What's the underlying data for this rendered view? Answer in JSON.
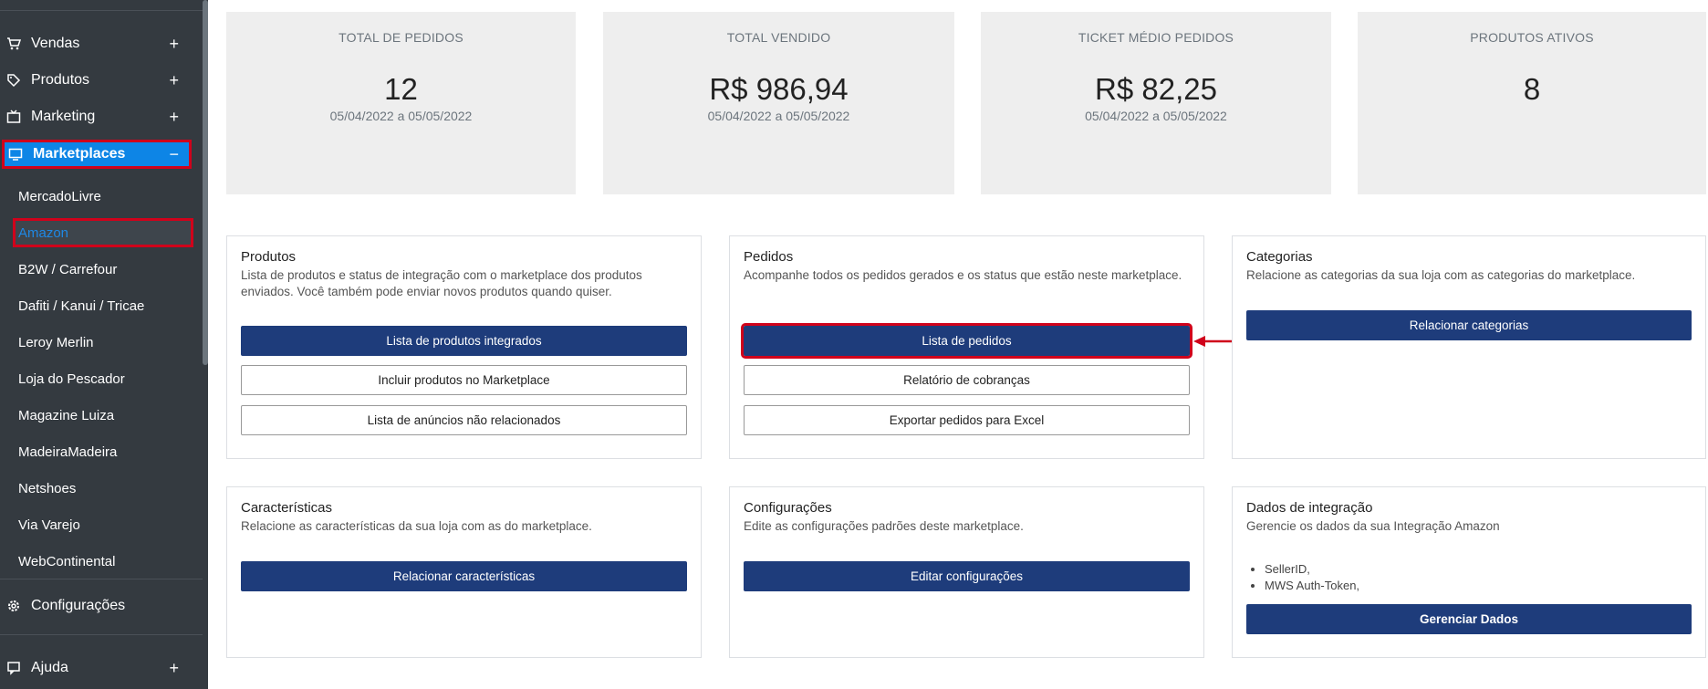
{
  "sidebar": {
    "items": [
      {
        "label": "Vendas",
        "icon": "cart-icon",
        "toggle": "+"
      },
      {
        "label": "Produtos",
        "icon": "tag-icon",
        "toggle": "+"
      },
      {
        "label": "Marketing",
        "icon": "tv-icon",
        "toggle": "+"
      },
      {
        "label": "Marketplaces",
        "icon": "monitor-icon",
        "toggle": "−"
      }
    ],
    "subitems": [
      "MercadoLivre",
      "Amazon",
      "B2W / Carrefour",
      "Dafiti / Kanui / Tricae",
      "Leroy Merlin",
      "Loja do Pescador",
      "Magazine Luiza",
      "MadeiraMadeira",
      "Netshoes",
      "Via Varejo",
      "WebContinental"
    ],
    "config_label": "Configurações",
    "help_label": "Ajuda",
    "help_toggle": "+"
  },
  "stats": [
    {
      "label": "TOTAL DE PEDIDOS",
      "value": "12",
      "range": "05/04/2022 a 05/05/2022"
    },
    {
      "label": "TOTAL VENDIDO",
      "value": "R$ 986,94",
      "range": "05/04/2022 a 05/05/2022"
    },
    {
      "label": "TICKET MÉDIO PEDIDOS",
      "value": "R$ 82,25",
      "range": "05/04/2022 a 05/05/2022"
    },
    {
      "label": "PRODUTOS ATIVOS",
      "value": "8",
      "range": ""
    }
  ],
  "cards": {
    "produtos": {
      "title": "Produtos",
      "desc": "Lista de produtos e status de integração com o marketplace dos produtos enviados. Você também pode enviar novos produtos quando quiser.",
      "btn1": "Lista de produtos integrados",
      "btn2": "Incluir produtos no Marketplace",
      "btn3": "Lista de anúncios não relacionados"
    },
    "pedidos": {
      "title": "Pedidos",
      "desc": "Acompanhe todos os pedidos gerados e os status que estão neste marketplace.",
      "btn1": "Lista de pedidos",
      "btn2": "Relatório de cobranças",
      "btn3": "Exportar pedidos para Excel"
    },
    "categorias": {
      "title": "Categorias",
      "desc": "Relacione as categorias da sua loja com as categorias do marketplace.",
      "btn1": "Relacionar categorias"
    },
    "caracteristicas": {
      "title": "Características",
      "desc": "Relacione as características da sua loja com as do marketplace.",
      "btn1": "Relacionar características"
    },
    "configuracoes": {
      "title": "Configurações",
      "desc": "Edite as configurações padrões deste marketplace.",
      "btn1": "Editar configurações"
    },
    "dados": {
      "title": "Dados de integração",
      "desc": "Gerencie os dados da sua Integração Amazon",
      "bullets": [
        "SellerID,",
        "MWS Auth-Token,"
      ],
      "btn1": "Gerenciar Dados"
    }
  },
  "colors": {
    "sidebar": "#343a40",
    "active": "#0d85e6",
    "primary": "#1e3c7b",
    "highlight": "#d0021b"
  }
}
